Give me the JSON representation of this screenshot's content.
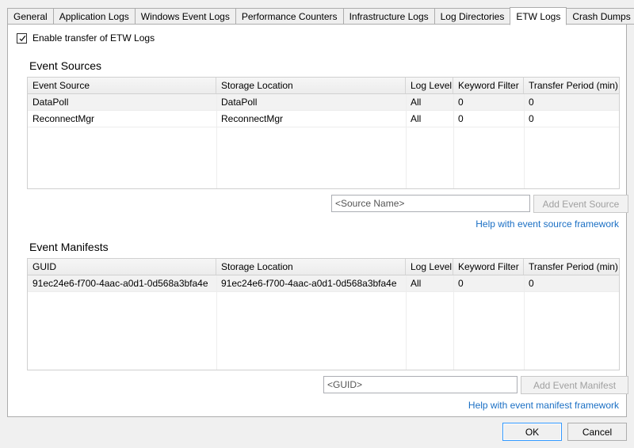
{
  "tabs": [
    {
      "label": "General",
      "selected": false
    },
    {
      "label": "Application Logs",
      "selected": false
    },
    {
      "label": "Windows Event Logs",
      "selected": false
    },
    {
      "label": "Performance Counters",
      "selected": false
    },
    {
      "label": "Infrastructure Logs",
      "selected": false
    },
    {
      "label": "Log Directories",
      "selected": false
    },
    {
      "label": "ETW Logs",
      "selected": true
    },
    {
      "label": "Crash Dumps",
      "selected": false
    }
  ],
  "enable_checkbox": {
    "label": "Enable transfer of ETW Logs",
    "checked": true,
    "icon": "checkmark-icon"
  },
  "event_sources": {
    "title": "Event Sources",
    "columns": [
      "Event Source",
      "Storage Location",
      "Log Level",
      "Keyword Filter",
      "Transfer Period (min)"
    ],
    "rows": [
      {
        "event_source": "DataPoll",
        "storage_location": "DataPoll",
        "log_level": "All",
        "keyword_filter": "0",
        "transfer_period": "0"
      },
      {
        "event_source": "ReconnectMgr",
        "storage_location": "ReconnectMgr",
        "log_level": "All",
        "keyword_filter": "0",
        "transfer_period": "0"
      }
    ],
    "input_placeholder": "<Source Name>",
    "input_value": "<Source Name>",
    "add_button_label": "Add Event Source",
    "add_button_enabled": false,
    "help_link": "Help with event source framework"
  },
  "event_manifests": {
    "title": "Event Manifests",
    "columns": [
      "GUID",
      "Storage Location",
      "Log Level",
      "Keyword Filter",
      "Transfer Period (min)"
    ],
    "rows": [
      {
        "guid": "91ec24e6-f700-4aac-a0d1-0d568a3bfa4e",
        "storage_location": "91ec24e6-f700-4aac-a0d1-0d568a3bfa4e",
        "log_level": "All",
        "keyword_filter": "0",
        "transfer_period": "0"
      }
    ],
    "input_placeholder": "<GUID>",
    "input_value": "<GUID>",
    "add_button_label": "Add Event Manifest",
    "add_button_enabled": false,
    "help_link": "Help with event manifest framework"
  },
  "footer": {
    "ok_label": "OK",
    "cancel_label": "Cancel"
  },
  "colors": {
    "link": "#1a6fc4",
    "focus_border": "#3399ff",
    "panel_bg": "#ffffff",
    "window_bg": "#f0f0f0",
    "border": "#acacac"
  }
}
